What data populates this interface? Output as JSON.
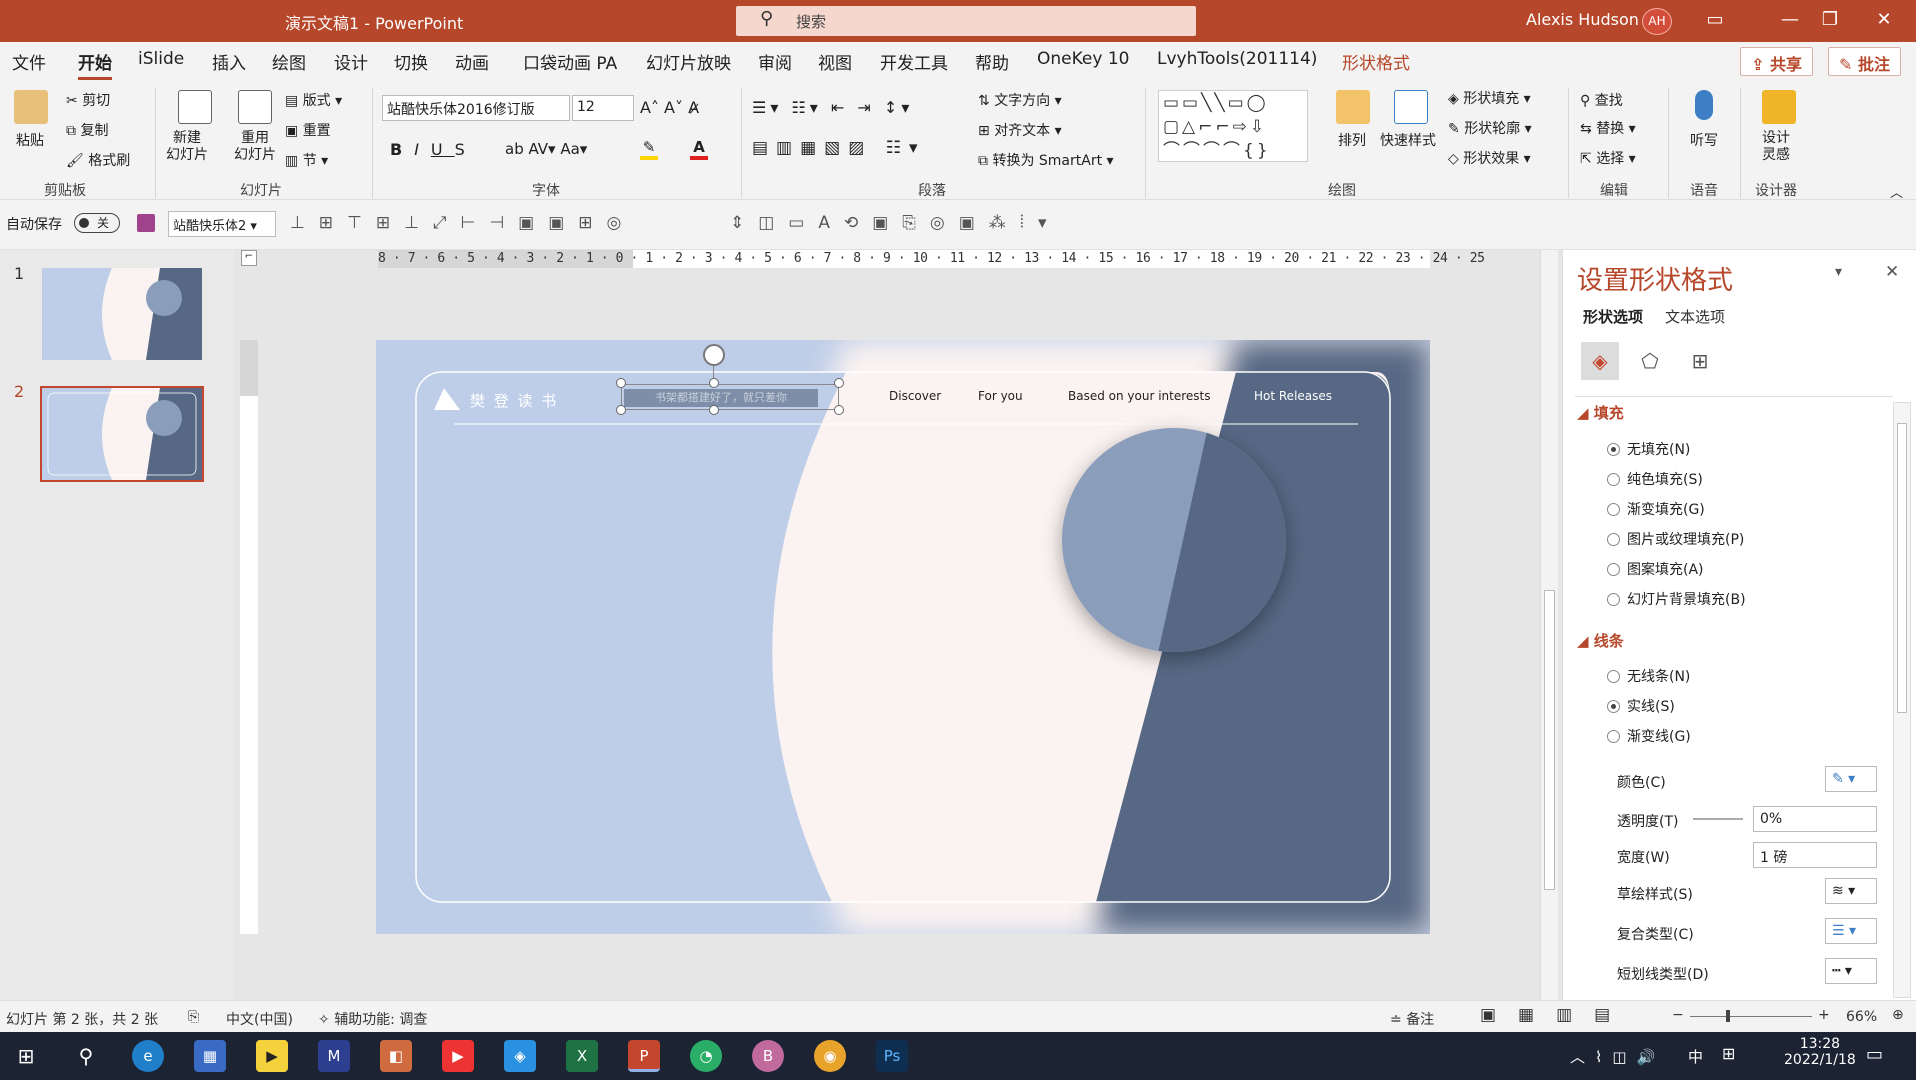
{
  "title": {
    "doc": "演示文稿1",
    "app": "PowerPoint"
  },
  "search": {
    "placeholder": "搜索"
  },
  "user": {
    "name": "Alexis Hudson",
    "initials": "AH"
  },
  "menu": [
    "文件",
    "开始",
    "iSlide",
    "插入",
    "绘图",
    "设计",
    "切换",
    "动画",
    "口袋动画 PA",
    "幻灯片放映",
    "审阅",
    "视图",
    "开发工具",
    "帮助",
    "OneKey 10",
    "LvyhTools(201114)",
    "形状格式"
  ],
  "share": {
    "share": "共享",
    "comment": "批注"
  },
  "ribbon": {
    "clipboard": {
      "paste": "粘贴",
      "cut": "剪切",
      "copy": "复制",
      "format_painter": "格式刷",
      "label": "剪贴板"
    },
    "slides": {
      "new": "新建\n幻灯片",
      "reuse": "重用\n幻灯片",
      "layout": "版式",
      "reset": "重置",
      "section": "节",
      "label": "幻灯片"
    },
    "font": {
      "name": "站酷快乐体2016修订版",
      "size": "12",
      "label": "字体"
    },
    "paragraph": {
      "text_direction": "文字方向",
      "align_text": "对齐文本",
      "smartart": "转换为 SmartArt",
      "label": "段落"
    },
    "drawing": {
      "arrange": "排列",
      "quick_styles": "快速样式",
      "fill": "形状填充",
      "outline": "形状轮廓",
      "effects": "形状效果",
      "label": "绘图"
    },
    "editing": {
      "find": "查找",
      "replace": "替换",
      "select": "选择",
      "label": "编辑"
    },
    "voice": {
      "dictate": "听写",
      "label": "语音"
    },
    "designer": {
      "ideas": "设计\n灵感",
      "label": "设计器"
    }
  },
  "qat": {
    "autosave": "自动保存",
    "toggle": "关",
    "font": "站酷快乐体2"
  },
  "thumbnails": [
    {
      "num": "1"
    },
    {
      "num": "2"
    }
  ],
  "ruler": "8 · 7 · 6 · 5 · 4 · 3 · 2 · 1 · 0 · 1 · 2 · 3 · 4 · 5 · 6 · 7 · 8 · 9 · 10 · 11 · 12 · 13 · 14 · 15 · 16 · 17 · 18 · 19 · 20 · 21 · 22 · 23 · 24 · 25",
  "slide": {
    "logo_text": "樊 登 读 书",
    "search_text": "书架都搭建好了，就只差你",
    "nav": [
      "Discover",
      "For you",
      "Based on your interests",
      "Hot Releases"
    ]
  },
  "pane": {
    "title": "设置形状格式",
    "tabs": [
      "形状选项",
      "文本选项"
    ],
    "fill_section": "填充",
    "fill_options": [
      "无填充(N)",
      "纯色填充(S)",
      "渐变填充(G)",
      "图片或纹理填充(P)",
      "图案填充(A)",
      "幻灯片背景填充(B)"
    ],
    "line_section": "线条",
    "line_options": [
      "无线条(N)",
      "实线(S)",
      "渐变线(G)"
    ],
    "color_label": "颜色(C)",
    "transparency_label": "透明度(T)",
    "transparency_value": "0%",
    "width_label": "宽度(W)",
    "width_value": "1 磅",
    "sketch_label": "草绘样式(S)",
    "compound_label": "复合类型(C)",
    "dash_label": "短划线类型(D)"
  },
  "status": {
    "slide": "幻灯片 第 2 张，共 2 张",
    "lang": "中文(中国)",
    "access": "辅助功能: 调查",
    "notes": "备注",
    "zoom": "66%"
  },
  "taskbar": {
    "time": "13:28",
    "date": "2022/1/18",
    "ime": "中"
  },
  "colors": {
    "accent": "#b7472a",
    "slide_light": "#bfcee8",
    "slide_cream": "#fbf3f1",
    "slide_dark": "#566884"
  }
}
